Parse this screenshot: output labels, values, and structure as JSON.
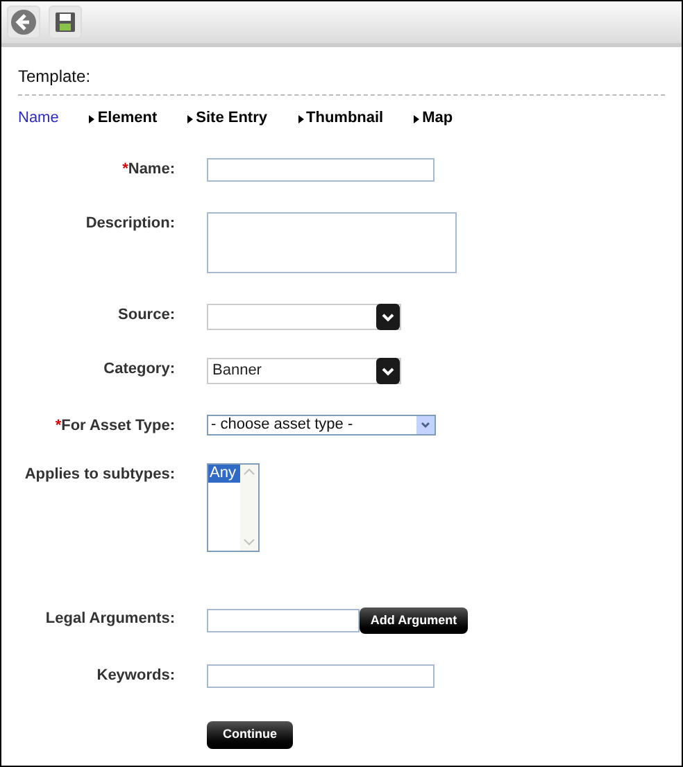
{
  "toolbar": {
    "buttons": [
      {
        "kind": "back"
      },
      {
        "kind": "save"
      }
    ]
  },
  "title": "Template:",
  "steps": [
    {
      "label": "Name",
      "selected": true
    },
    {
      "label": "Element",
      "selected": false
    },
    {
      "label": "Site Entry",
      "selected": false
    },
    {
      "label": "Thumbnail",
      "selected": false
    },
    {
      "label": "Map",
      "selected": false
    }
  ],
  "required_mark": "*",
  "fields": [
    {
      "kind": "text",
      "label": "Name:",
      "required": true
    },
    {
      "kind": "textarea",
      "label": "Description:",
      "required": false
    },
    {
      "kind": "dropdown",
      "label": "Source:",
      "required": false
    },
    {
      "kind": "dropdown",
      "label": "Category:",
      "required": false,
      "value": "Banner"
    },
    {
      "kind": "select",
      "label": "For Asset Type:",
      "required": true,
      "value": "- choose asset type -"
    },
    {
      "kind": "listbox",
      "label": "Applies to subtypes:",
      "required": false,
      "options": [
        {
          "label": "Any",
          "selected": true
        }
      ]
    },
    {
      "kind": "text_button",
      "label": "Legal Arguments:",
      "required": false,
      "button": "Add Argument"
    },
    {
      "kind": "text",
      "label": "Keywords:",
      "required": false
    }
  ],
  "submit": "Continue"
}
